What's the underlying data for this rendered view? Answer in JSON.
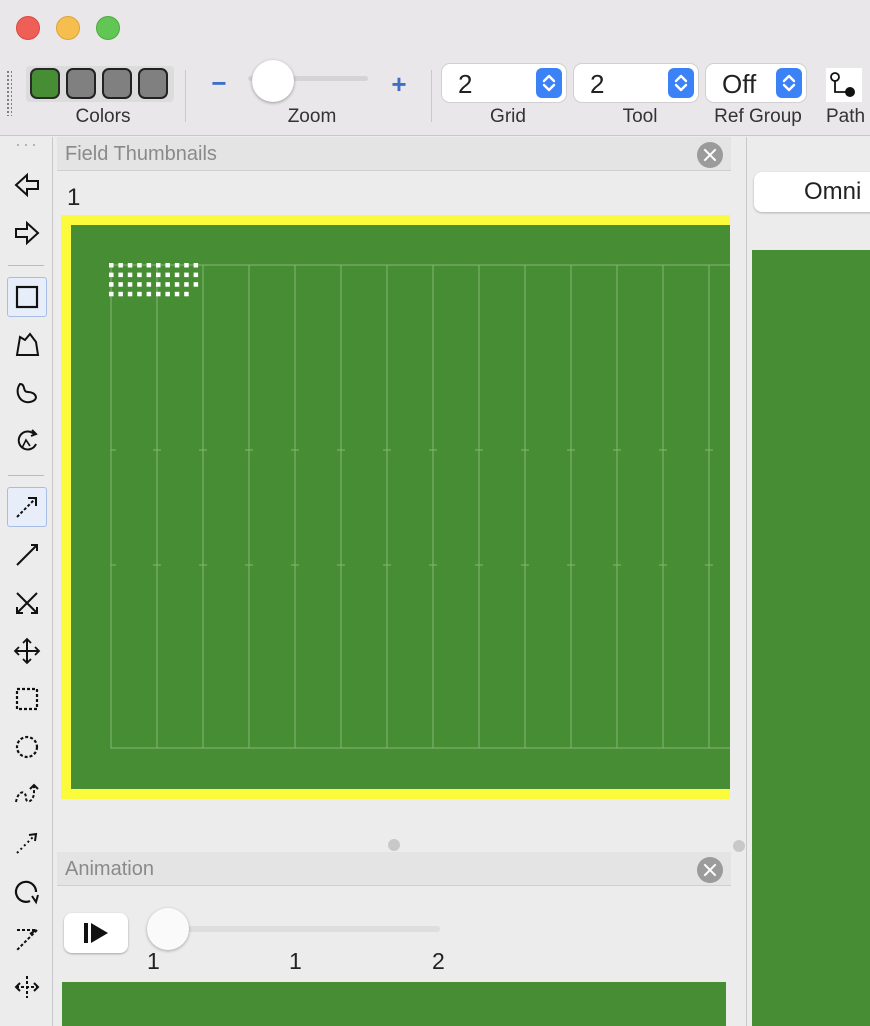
{
  "toolbar": {
    "colors_label": "Colors",
    "zoom_label": "Zoom",
    "zoom_minus": "−",
    "zoom_plus": "+",
    "grid_label": "Grid",
    "grid_value": "2",
    "tool_label": "Tool",
    "tool_value": "2",
    "ref_group_label": "Ref Group",
    "ref_group_value": "Off",
    "path_label": "Path",
    "swatches": [
      "#478d34",
      "#808080",
      "#808080",
      "#808080"
    ]
  },
  "palette": {
    "tools": [
      "previous-arrow-icon",
      "next-arrow-icon",
      "rectangle-icon",
      "polygon-icon",
      "freeform-shape-icon",
      "rotate-shape-icon",
      "route-arrow-icon",
      "line-arrow-icon",
      "cross-routes-icon",
      "move-cross-icon",
      "square-dotted-icon",
      "circle-dotted-icon",
      "curl-route-icon",
      "dotted-arrow-icon",
      "loop-route-icon",
      "angled-route-icon",
      "split-route-icon"
    ]
  },
  "field_thumbnails": {
    "title": "Field Thumbnails",
    "thumb_number": "1",
    "field_color": "#478d34",
    "highlight_color": "#fbfb3c"
  },
  "animation": {
    "title": "Animation",
    "ticks": [
      "1",
      "1",
      "2"
    ]
  },
  "right_panel": {
    "omni_label": "Omni"
  }
}
